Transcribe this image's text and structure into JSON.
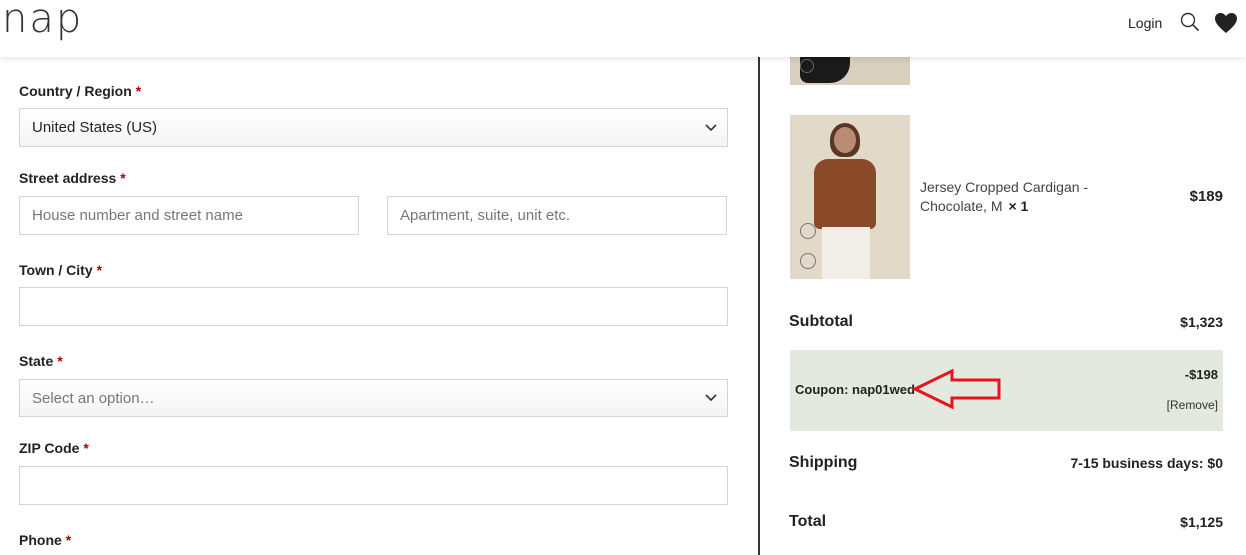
{
  "header": {
    "logo": "nap",
    "login": "Login"
  },
  "form": {
    "country": {
      "label": "Country / Region",
      "required": "*",
      "value": "United States (US)"
    },
    "street": {
      "label": "Street address",
      "required": "*",
      "placeholder1": "House number and street name",
      "placeholder2": "Apartment, suite, unit etc."
    },
    "town": {
      "label": "Town / City",
      "required": "*",
      "value": ""
    },
    "state": {
      "label": "State",
      "required": "*",
      "placeholder": "Select an option…"
    },
    "zip": {
      "label": "ZIP Code",
      "required": "*",
      "value": ""
    },
    "phone": {
      "label": "Phone",
      "required": "*"
    }
  },
  "order": {
    "product": {
      "name": "Jersey Cropped Cardigan - Chocolate, M",
      "qty": "× 1",
      "price": "$189"
    },
    "subtotal": {
      "label": "Subtotal",
      "value": "$1,323"
    },
    "coupon": {
      "label": "Coupon: nap01wed",
      "amount": "-$198",
      "remove": "[Remove]"
    },
    "shipping": {
      "label": "Shipping",
      "value": "7-15 business days: $0"
    },
    "total": {
      "label": "Total",
      "value": "$1,125"
    }
  },
  "colors": {
    "required": "#aa0000",
    "coupon_bg": "#e3e9de",
    "annotation_arrow": "#e8141c",
    "divider": "#333333"
  },
  "icons": [
    "search-icon",
    "heart-icon",
    "chevron-down-icon",
    "arrow-annotation-icon"
  ]
}
